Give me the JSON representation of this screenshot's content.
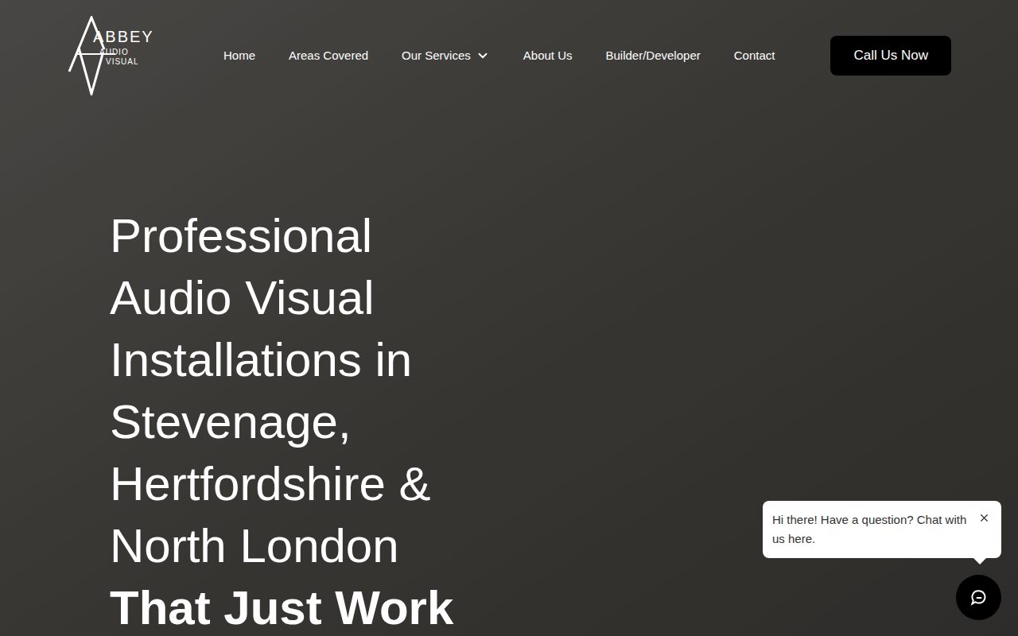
{
  "logo": {
    "name": "ABBEY",
    "line1": "AUDIO",
    "line2": "VISUAL"
  },
  "nav": [
    {
      "label": "Home",
      "dropdown": false
    },
    {
      "label": "Areas Covered",
      "dropdown": false
    },
    {
      "label": "Our Services",
      "dropdown": true
    },
    {
      "label": "About Us",
      "dropdown": false
    },
    {
      "label": "Builder/Developer",
      "dropdown": false
    },
    {
      "label": "Contact",
      "dropdown": false
    }
  ],
  "cta_button": "Call Us Now",
  "hero": {
    "lines": [
      {
        "text": "Professional",
        "bold": false
      },
      {
        "text": "Audio Visual",
        "bold": false
      },
      {
        "text": "Installations in",
        "bold": false
      },
      {
        "text": "Stevenage,",
        "bold": false
      },
      {
        "text": "Hertfordshire &",
        "bold": false
      },
      {
        "text": "North London",
        "bold": false
      },
      {
        "text": "That Just Work",
        "bold": true
      }
    ]
  },
  "chat": {
    "message": "Hi there! Have a question? Chat with us here.",
    "open": true
  }
}
